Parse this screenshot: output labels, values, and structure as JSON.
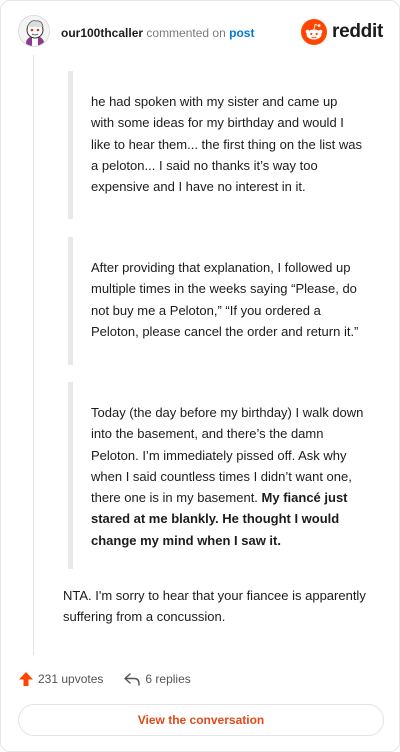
{
  "header": {
    "username": "our100thcaller",
    "action_text": "commented on",
    "post_link": "post",
    "brand": "reddit"
  },
  "quotes": [
    {
      "text": "he had spoken with my sister and came up with some ideas for my birthday and would I like to hear them... the first thing on the list was a peloton... I said no thanks it’s way too expensive and I have no interest in it."
    },
    {
      "text": "After providing that explanation, I followed up multiple times in the weeks saying “Please, do not buy me a Peloton,” “If you ordered a Peloton, please cancel the order and return it.”"
    },
    {
      "text": "Today (the day before my birthday) I walk down into the basement, and there’s the damn Peloton. I’m immediately pissed off. Ask why when I said countless times I didn’t want one, there one is in my basement.",
      "bold": "My fiancé just stared at me blankly. He thought I would change my mind when I saw it."
    }
  ],
  "reply": {
    "text": "NTA. I'm sorry to hear that your fiancee is apparently suffering from a concussion."
  },
  "actions": {
    "upvotes": "231 upvotes",
    "replies": "6 replies"
  },
  "view_button": "View the conversation",
  "colors": {
    "reddit_orange": "#ff4500",
    "link_blue": "#0079d3",
    "button_text": "#e04a18",
    "quote_bar": "#e9e9e9"
  },
  "icons": {
    "avatar": "snoo-avatar",
    "logo": "reddit-snoo-icon",
    "upvote": "upvote-arrow-icon",
    "reply": "reply-arrow-icon"
  }
}
